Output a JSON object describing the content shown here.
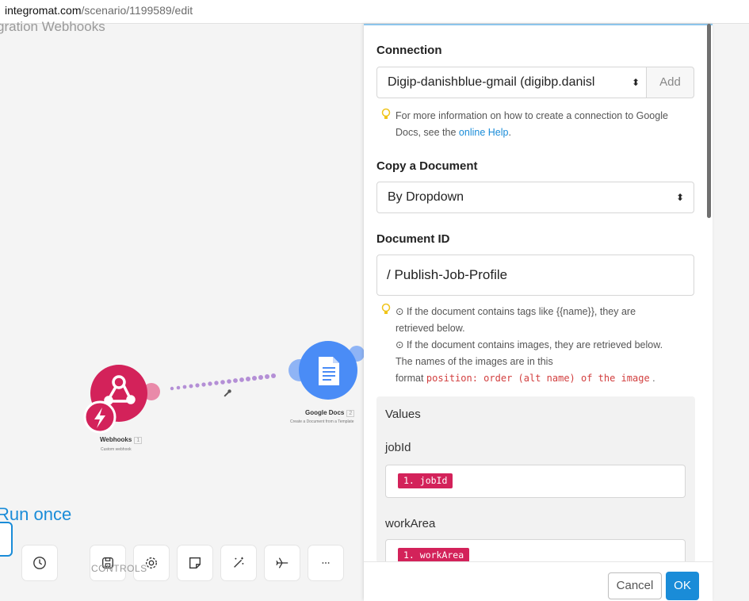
{
  "browser": {
    "url_host": "integromat.com",
    "url_path": "/scenario/1199589/edit"
  },
  "scenario": {
    "name": "gration Webhooks",
    "nodes": [
      {
        "title": "Webhooks",
        "count": "1",
        "subtitle": "Custom webhook"
      },
      {
        "title": "Google Docs",
        "count": "2",
        "subtitle": "Create a Document from a Template"
      }
    ],
    "run_once_label": "Run once",
    "controls_label": "CONTROLS"
  },
  "panel": {
    "connection": {
      "label": "Connection",
      "value": "Digip-danishblue-gmail (digibp.danisl",
      "add_label": "Add",
      "hint_prefix": "For more information on how to create a connection to Google Docs, see the",
      "hint_link": "online Help",
      "hint_suffix": "."
    },
    "copy_document": {
      "label": "Copy a Document",
      "value": "By Dropdown"
    },
    "document_id": {
      "label": "Document ID",
      "value": "/ Publish-Job-Profile",
      "hint_line1": "⊙ If the document contains tags like {{name}}, they are retrieved below.",
      "hint_line2": "⊙ If the document contains images, they are retrieved below. The names of the images are in this",
      "hint_format_prefix": "format",
      "hint_format_code": "position: order (alt name) of the image",
      "hint_format_suffix": "."
    },
    "values": {
      "title": "Values",
      "fields": [
        {
          "label": "jobId",
          "pill": "1. jobId"
        },
        {
          "label": "workArea",
          "pill": "1. workArea"
        }
      ]
    },
    "footer": {
      "cancel_label": "Cancel",
      "ok_label": "OK"
    }
  },
  "colors": {
    "accent": "#1a8cd8",
    "webhooks": "#d3225a",
    "google_docs": "#4a8cf6",
    "pill": "#d3225a"
  }
}
